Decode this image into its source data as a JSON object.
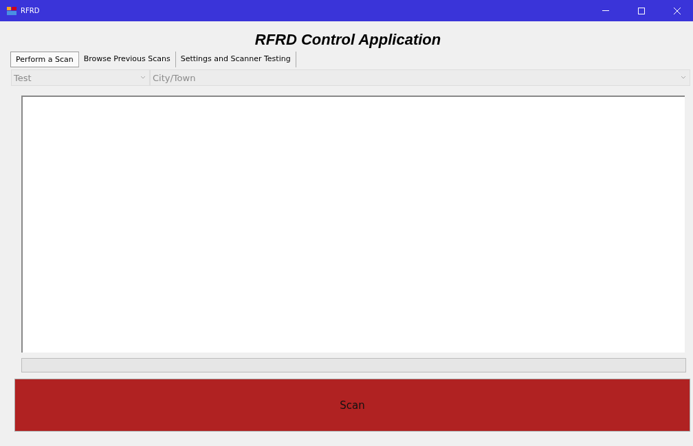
{
  "window": {
    "title": "RFRD"
  },
  "heading": "RFRD Control Application",
  "tabs": [
    {
      "label": "Perform a Scan",
      "selected": true
    },
    {
      "label": "Browse Previous Scans",
      "selected": false
    },
    {
      "label": "Settings and Scanner Testing",
      "selected": false
    }
  ],
  "dropdowns": [
    {
      "value": "Test",
      "disabled": true
    },
    {
      "value": "City/Town",
      "disabled": true
    }
  ],
  "progress": {
    "level": 0
  },
  "scan_button": {
    "label": "Scan"
  }
}
